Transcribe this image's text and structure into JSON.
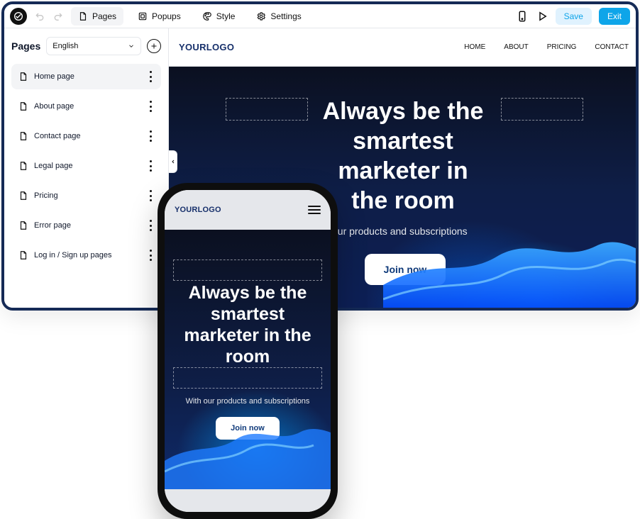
{
  "topbar": {
    "tabs": [
      {
        "label": "Pages",
        "icon": "page-icon",
        "active": true
      },
      {
        "label": "Popups",
        "icon": "popup-icon"
      },
      {
        "label": "Style",
        "icon": "palette-icon"
      },
      {
        "label": "Settings",
        "icon": "gear-icon"
      }
    ],
    "save_label": "Save",
    "exit_label": "Exit"
  },
  "sidebar": {
    "title": "Pages",
    "language": "English",
    "items": [
      {
        "label": "Home page",
        "active": true
      },
      {
        "label": "About page"
      },
      {
        "label": "Contact page"
      },
      {
        "label": "Legal page"
      },
      {
        "label": "Pricing"
      },
      {
        "label": "Error page"
      },
      {
        "label": "Log in / Sign up pages"
      }
    ]
  },
  "site": {
    "logo": "YOURLOGO",
    "nav": [
      "HOME",
      "ABOUT",
      "PRICING",
      "CONTACT"
    ],
    "hero": {
      "title": "Always be the smartest marketer in the room",
      "subtitle": "our products and subscriptions",
      "button": "Join now"
    }
  },
  "mobile": {
    "logo": "YOURLOGO",
    "hero": {
      "title": "Always be the smartest marketer in the room",
      "subtitle": "With our products and subscriptions",
      "button": "Join now"
    }
  },
  "colors": {
    "accent": "#0ea5e9",
    "logo": "#17306b"
  }
}
